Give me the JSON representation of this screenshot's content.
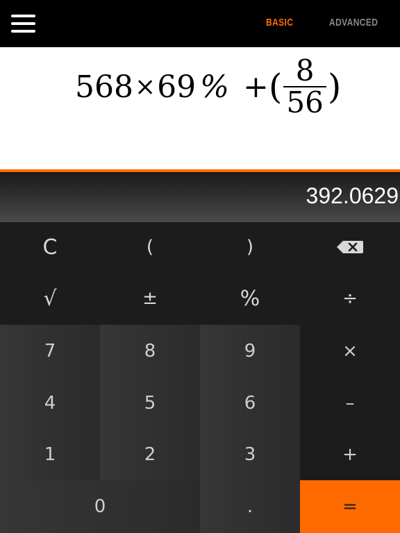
{
  "header": {
    "tabs": [
      {
        "label": "BASIC",
        "active": true
      },
      {
        "label": "ADVANCED",
        "active": false
      }
    ]
  },
  "expression": {
    "part1": "568",
    "times": "×",
    "part2": "69",
    "percent": "%",
    "plus": "+",
    "open_paren": "(",
    "numerator": "8",
    "denominator": "56",
    "close_paren": ")"
  },
  "result": "392.0629",
  "keypad": {
    "clear": "C",
    "open_paren": "(",
    "close_paren": ")",
    "sqrt": "√",
    "plus_minus": "±",
    "percent": "%",
    "divide": "÷",
    "seven": "7",
    "eight": "8",
    "nine": "9",
    "multiply": "×",
    "four": "4",
    "five": "5",
    "six": "6",
    "minus": "–",
    "one": "1",
    "two": "2",
    "three": "3",
    "plus": "+",
    "zero": "0",
    "decimal": ".",
    "equals": "="
  },
  "colors": {
    "accent": "#ff6a00",
    "inactive_tab": "#8a8a8a"
  }
}
